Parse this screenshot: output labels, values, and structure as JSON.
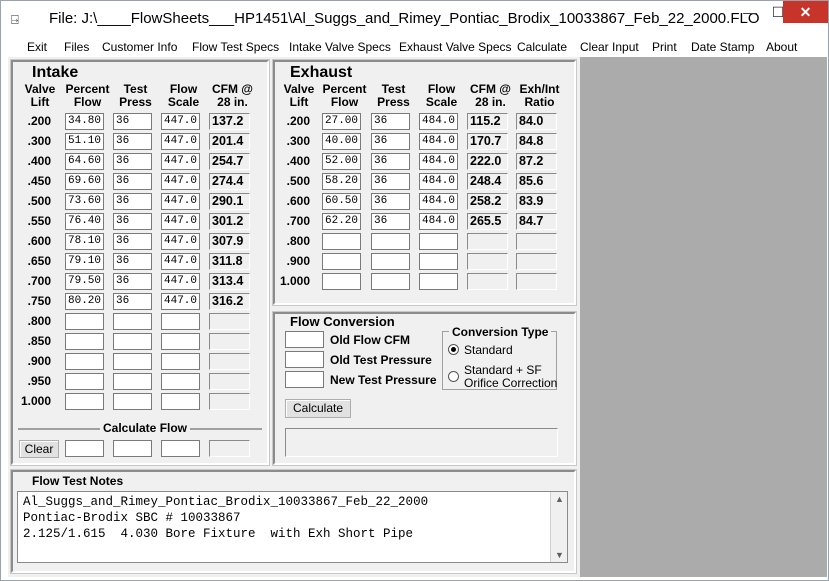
{
  "window": {
    "title": "File:  J:\\____FlowSheets___HP1451\\Al_Suggs_and_Rimey_Pontiac_Brodix_10033867_Feb_22_2000.FLO",
    "icon": "app-icon",
    "min_label": "—",
    "max_label": "☐",
    "close_label": "✕"
  },
  "menu": [
    "Exit",
    "Files",
    "Customer Info",
    "Flow Test Specs",
    "Intake Valve Specs",
    "Exhaust Valve Specs",
    "Calculate",
    "Clear Input",
    "Print",
    "Date Stamp",
    "About"
  ],
  "intake": {
    "title": "Intake",
    "headers": [
      "Valve\nLift",
      "Percent\nFlow",
      "Test\nPress",
      "Flow\nScale",
      "CFM @\n28 in."
    ],
    "rows": [
      {
        "lift": ".200",
        "pct": "34.80",
        "press": "36",
        "scale": "447.0",
        "cfm": "137.2"
      },
      {
        "lift": ".300",
        "pct": "51.10",
        "press": "36",
        "scale": "447.0",
        "cfm": "201.4"
      },
      {
        "lift": ".400",
        "pct": "64.60",
        "press": "36",
        "scale": "447.0",
        "cfm": "254.7"
      },
      {
        "lift": ".450",
        "pct": "69.60",
        "press": "36",
        "scale": "447.0",
        "cfm": "274.4"
      },
      {
        "lift": ".500",
        "pct": "73.60",
        "press": "36",
        "scale": "447.0",
        "cfm": "290.1"
      },
      {
        "lift": ".550",
        "pct": "76.40",
        "press": "36",
        "scale": "447.0",
        "cfm": "301.2"
      },
      {
        "lift": ".600",
        "pct": "78.10",
        "press": "36",
        "scale": "447.0",
        "cfm": "307.9"
      },
      {
        "lift": ".650",
        "pct": "79.10",
        "press": "36",
        "scale": "447.0",
        "cfm": "311.8"
      },
      {
        "lift": ".700",
        "pct": "79.50",
        "press": "36",
        "scale": "447.0",
        "cfm": "313.4"
      },
      {
        "lift": ".750",
        "pct": "80.20",
        "press": "36",
        "scale": "447.0",
        "cfm": "316.2"
      },
      {
        "lift": ".800",
        "pct": "",
        "press": "",
        "scale": "",
        "cfm": ""
      },
      {
        "lift": ".850",
        "pct": "",
        "press": "",
        "scale": "",
        "cfm": ""
      },
      {
        "lift": ".900",
        "pct": "",
        "press": "",
        "scale": "",
        "cfm": ""
      },
      {
        "lift": ".950",
        "pct": "",
        "press": "",
        "scale": "",
        "cfm": ""
      },
      {
        "lift": "1.000",
        "pct": "",
        "press": "",
        "scale": "",
        "cfm": ""
      }
    ],
    "calc_title": "Calculate Flow",
    "clear_label": "Clear"
  },
  "exhaust": {
    "title": "Exhaust",
    "headers": [
      "Valve\nLift",
      "Percent\nFlow",
      "Test\nPress",
      "Flow\nScale",
      "CFM @\n28 in.",
      "Exh/Int\nRatio"
    ],
    "rows": [
      {
        "lift": ".200",
        "pct": "27.00",
        "press": "36",
        "scale": "484.0",
        "cfm": "115.2",
        "ratio": "84.0"
      },
      {
        "lift": ".300",
        "pct": "40.00",
        "press": "36",
        "scale": "484.0",
        "cfm": "170.7",
        "ratio": "84.8"
      },
      {
        "lift": ".400",
        "pct": "52.00",
        "press": "36",
        "scale": "484.0",
        "cfm": "222.0",
        "ratio": "87.2"
      },
      {
        "lift": ".500",
        "pct": "58.20",
        "press": "36",
        "scale": "484.0",
        "cfm": "248.4",
        "ratio": "85.6"
      },
      {
        "lift": ".600",
        "pct": "60.50",
        "press": "36",
        "scale": "484.0",
        "cfm": "258.2",
        "ratio": "83.9"
      },
      {
        "lift": ".700",
        "pct": "62.20",
        "press": "36",
        "scale": "484.0",
        "cfm": "265.5",
        "ratio": "84.7"
      },
      {
        "lift": ".800",
        "pct": "",
        "press": "",
        "scale": "",
        "cfm": "",
        "ratio": ""
      },
      {
        "lift": ".900",
        "pct": "",
        "press": "",
        "scale": "",
        "cfm": "",
        "ratio": ""
      },
      {
        "lift": "1.000",
        "pct": "",
        "press": "",
        "scale": "",
        "cfm": "",
        "ratio": ""
      }
    ]
  },
  "conversion": {
    "title": "Flow Conversion",
    "old_flow_label": "Old Flow CFM",
    "old_press_label": "Old Test Pressure",
    "new_press_label": "New Test Pressure",
    "type_title": "Conversion Type",
    "opt1": "Standard",
    "opt2a": "Standard + SF",
    "opt2b": "Orifice Correction",
    "selected": "Standard",
    "calc_label": "Calculate",
    "result": ""
  },
  "notes": {
    "title": "Flow Test Notes",
    "lines": [
      "Al_Suggs_and_Rimey_Pontiac_Brodix_10033867_Feb_22_2000",
      "Pontiac-Brodix SBC # 10033867",
      "2.125/1.615  4.030 Bore Fixture  with Exh Short Pipe"
    ]
  }
}
